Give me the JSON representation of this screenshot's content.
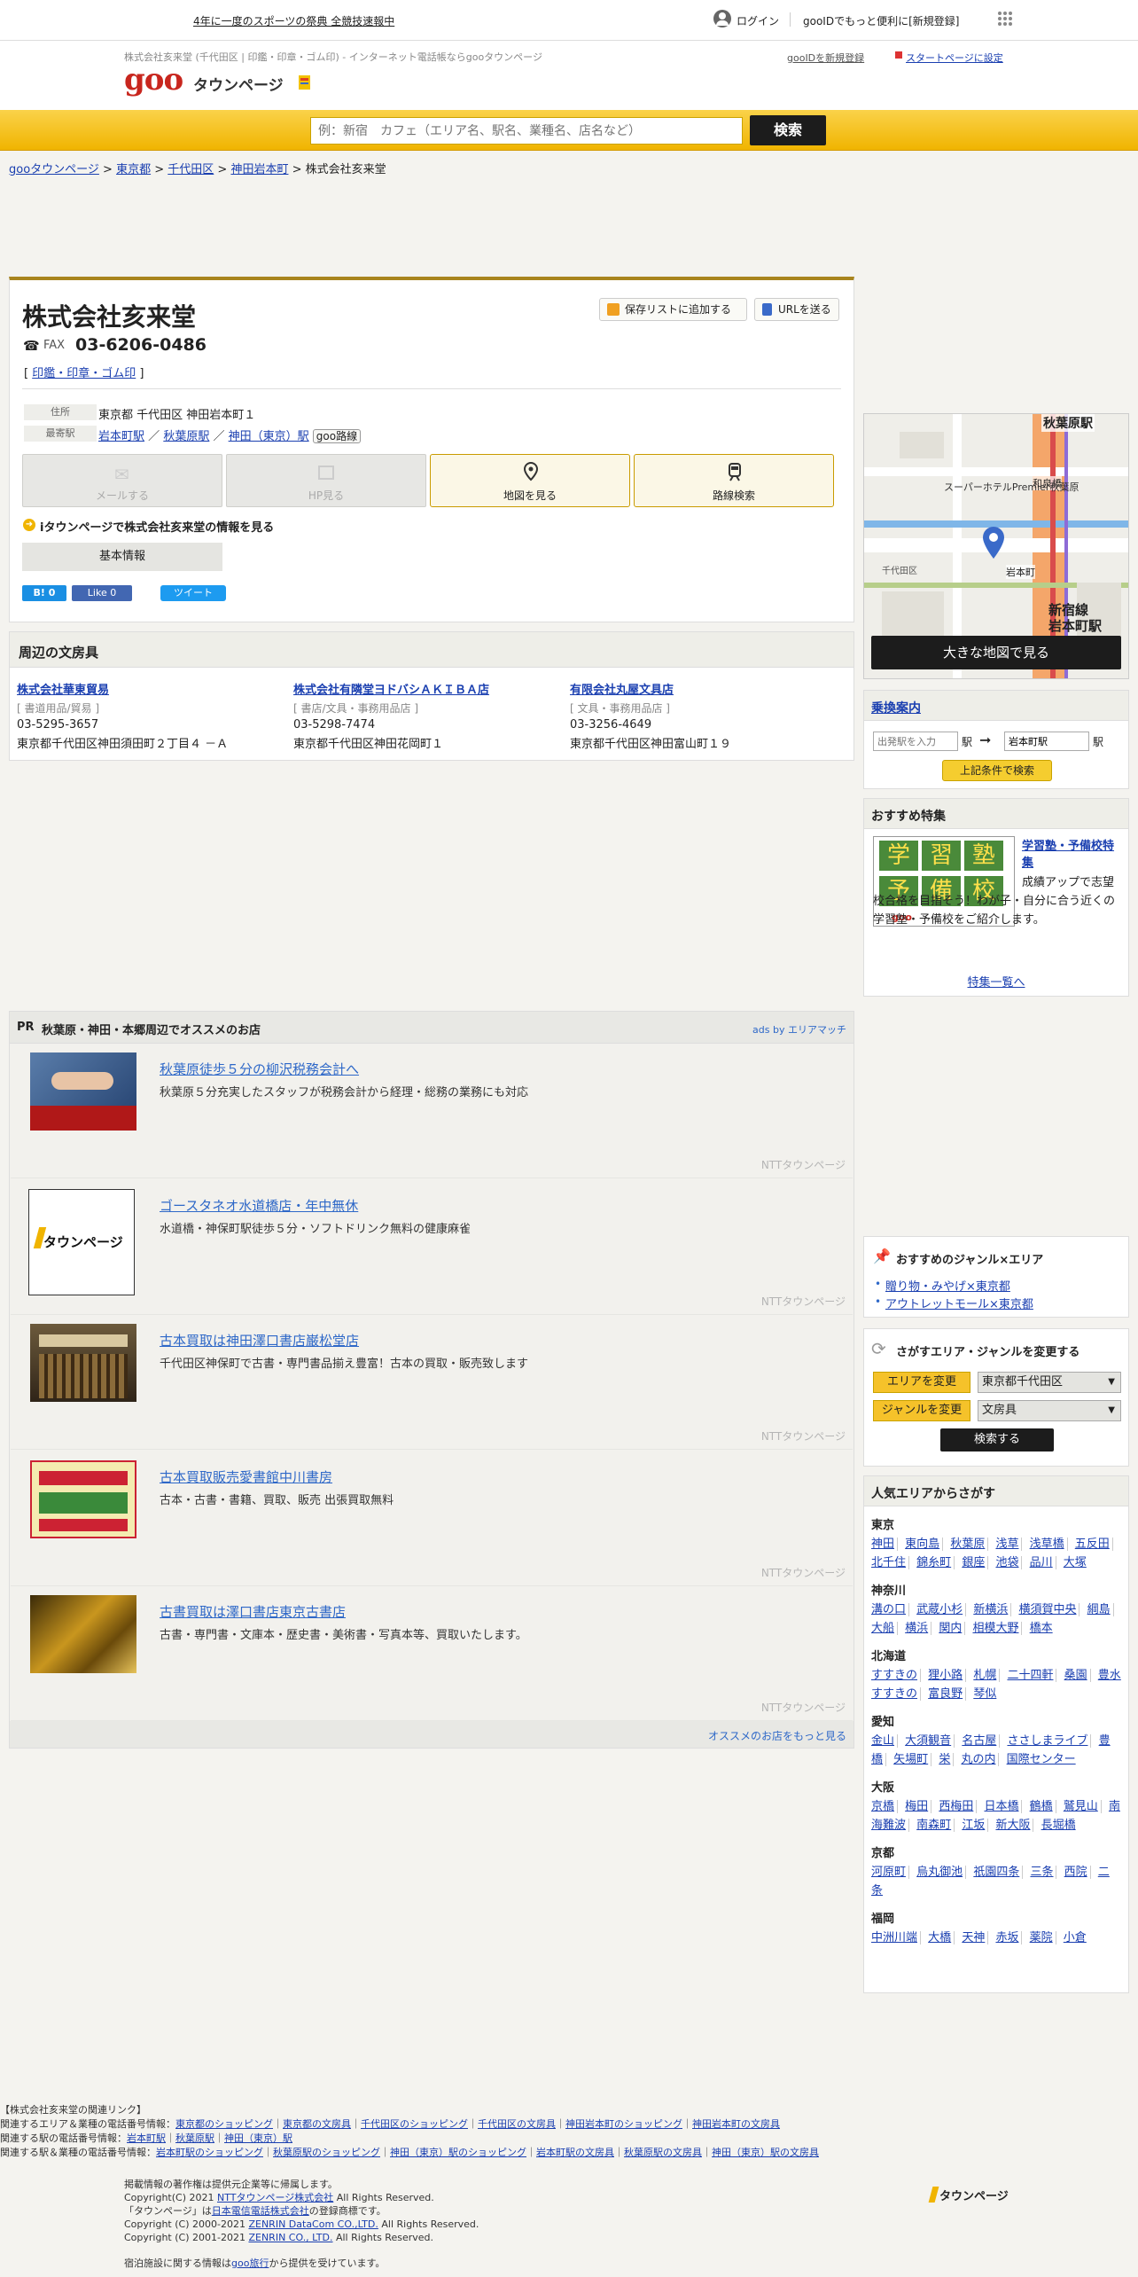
{
  "topbar": {
    "promo": "4年に一度のスポーツの祭典 全競技速報中",
    "login": "ログイン",
    "gooid": "gooIDでもっと便利に[新規登録]"
  },
  "header": {
    "tagline": "株式会社亥来堂 (千代田区 | 印鑑・印章・ゴム印) - インターネット電話帳ならgooタウンページ",
    "logo_goo": "goo",
    "logo_town": "タウンページ",
    "gooid_register": "gooIDを新規登録",
    "startpage": "スタートページに設定"
  },
  "search": {
    "placeholder": "例：新宿　カフェ（エリア名、駅名、業種名、店名など）",
    "button": "検索"
  },
  "breadcrumb": {
    "b1": "gooタウンページ",
    "b2": "東京都",
    "b3": "千代田区",
    "b4": "神田岩本町",
    "current": "株式会社亥来堂",
    "sep": " > "
  },
  "company": {
    "name": "株式会社亥来堂",
    "fax_label": "FAX",
    "fax": "03-6206-0486",
    "category": "印鑑・印章・ゴム印",
    "save_btn": "保存リストに追加する",
    "url_btn": "URLを送る",
    "addr_label": "住所",
    "addr": "東京都 千代田区 神田岩本町１",
    "station_label": "最寄駅",
    "st1": "岩本町駅",
    "st2": "秋葉原駅",
    "st3": "神田（東京）駅",
    "route_tag": "goo路線",
    "slash": "／"
  },
  "actions": {
    "mail": "メールする",
    "hp": "HP見る",
    "map": "地図を見る",
    "route": "路線検索"
  },
  "itown": "iタウンページで株式会社亥来堂の情報を見る",
  "basic_tab": "基本情報",
  "social": {
    "hatena": "B! 0",
    "like": "Like 0",
    "tweet": "ツイート"
  },
  "nearby": {
    "title": "周辺の文房具",
    "items": [
      {
        "name": "株式会社華東貿易",
        "cat": "[ 書道用品/貿易 ]",
        "tel": "03-5295-3657",
        "addr": "東京都千代田区神田須田町２丁目４ －Ａ"
      },
      {
        "name": "株式会社有隣堂ヨドバシＡＫＩＢＡ店",
        "cat": "[ 書店/文具・事務用品店 ]",
        "tel": "03-5298-7474",
        "addr": "東京都千代田区神田花岡町１"
      },
      {
        "name": "有限会社丸屋文具店",
        "cat": "[ 文具・事務用品店 ]",
        "tel": "03-3256-4649",
        "addr": "東京都千代田区神田富山町１９"
      }
    ]
  },
  "pr": {
    "label": "PR",
    "title": "秋葉原・神田・本郷周辺でオススメのお店",
    "ads": "ads by エリアマッチ",
    "ntt": "NTTタウンページ",
    "more": "オススメのお店をもっと見る",
    "items": [
      {
        "title": "秋葉原徒歩５分の柳沢税務会計へ",
        "desc": "秋葉原５分充実したスタッフが税務会計から経理・総務の業務にも対応"
      },
      {
        "title": "ゴースタネオ水道橋店・年中無休",
        "desc": "水道橋・神保町駅徒歩５分・ソフトドリンク無料の健康麻雀"
      },
      {
        "title": "古本買取は神田澤口書店巌松堂店",
        "desc": "千代田区神保町で古書・専門書品揃え豊富！古本の買取・販売致します"
      },
      {
        "title": "古本買取販売愛書館中川書房",
        "desc": "古本・古書・書籍、買取、販売 出張買取無料"
      },
      {
        "title": "古書買取は澤口書店東京古書店",
        "desc": "古書・専門書・文庫本・歴史書・美術書・写真本等、買取いたします。"
      }
    ]
  },
  "map": {
    "labels": {
      "akihabara": "秋葉原駅",
      "iwamotocho": "岩本町",
      "shinjukusen": "新宿線",
      "iwamotocho_eki": "岩本町駅",
      "wazumi": "和泉橋",
      "hotel": "スーパーホテルPremier秋葉原",
      "kanda": "千代田区"
    },
    "button": "大きな地図で見る"
  },
  "transit": {
    "title": "乗換案内",
    "from_placeholder": "出発駅を入力",
    "eki1": "駅",
    "to_value": "岩本町駅",
    "eki2": "駅",
    "button": "上記条件で検索"
  },
  "feature": {
    "title": "おすすめ特集",
    "link": "学習塾・予備校特集",
    "desc": "成績アップで志望校合格を目指そう！わが子・自分に合う近くの学習塾・予備校をご紹介します。",
    "more": "特集一覧へ",
    "img_chars": [
      "学",
      "習",
      "塾",
      "予",
      "備",
      "校"
    ]
  },
  "genre": {
    "title": "おすすめのジャンル×エリア",
    "l1": "贈り物・みやげ×東京都",
    "l2": "アウトレットモール×東京都"
  },
  "change": {
    "title": "さがすエリア・ジャンルを変更する",
    "area_btn": "エリアを変更",
    "area_val": "東京都千代田区",
    "genre_btn": "ジャンルを変更",
    "genre_val": "文房具",
    "search": "検索する"
  },
  "popular": {
    "title": "人気エリアからさがす",
    "regions": [
      {
        "name": "東京",
        "areas": [
          "神田",
          "東向島",
          "秋葉原",
          "浅草",
          "浅草橋",
          "五反田",
          "北千住",
          "錦糸町",
          "銀座",
          "池袋",
          "品川",
          "大塚"
        ]
      },
      {
        "name": "神奈川",
        "areas": [
          "溝の口",
          "武蔵小杉",
          "新横浜",
          "横須賀中央",
          "綱島",
          "大船",
          "横浜",
          "関内",
          "相模大野",
          "橋本"
        ]
      },
      {
        "name": "北海道",
        "areas": [
          "すすきの",
          "狸小路",
          "札幌",
          "二十四軒",
          "桑園",
          "豊水すすきの",
          "富良野",
          "琴似"
        ]
      },
      {
        "name": "愛知",
        "areas": [
          "金山",
          "大須観音",
          "名古屋",
          "ささしまライブ",
          "豊橋",
          "矢場町",
          "栄",
          "丸の内",
          "国際センター"
        ]
      },
      {
        "name": "大阪",
        "areas": [
          "京橋",
          "梅田",
          "西梅田",
          "日本橋",
          "鶴橋",
          "鷲見山",
          "南海難波",
          "南森町",
          "江坂",
          "新大阪",
          "長堀橋"
        ]
      },
      {
        "name": "京都",
        "areas": [
          "河原町",
          "烏丸御池",
          "祇園四条",
          "三条",
          "西院",
          "二条"
        ]
      },
      {
        "name": "福岡",
        "areas": [
          "中洲川端",
          "大橋",
          "天神",
          "赤坂",
          "薬院",
          "小倉"
        ]
      }
    ]
  },
  "related": {
    "head": "【株式会社亥来堂の関連リンク】",
    "r1_label": "関連するエリア＆業種の電話番号情報：",
    "r1": [
      "東京都のショッピング",
      "東京都の文房具",
      "千代田区のショッピング",
      "千代田区の文房具",
      "神田岩本町のショッピング",
      "神田岩本町の文房具"
    ],
    "r2_label": "関連する駅の電話番号情報：",
    "r2": [
      "岩本町駅",
      "秋葉原駅",
      "神田（東京）駅"
    ],
    "r3_label": "関連する駅＆業種の電話番号情報：",
    "r3": [
      "岩本町駅のショッピング",
      "秋葉原駅のショッピング",
      "神田（東京）駅のショッピング",
      "岩本町駅の文房具",
      "秋葉原駅の文房具",
      "神田（東京）駅の文房具"
    ]
  },
  "footer": {
    "l1": "掲載情報の著作権は提供元企業等に帰属します。",
    "l2a": "Copyright(C) 2021 ",
    "l2b": "NTTタウンページ株式会社",
    "l2c": " All Rights Reserved.",
    "l3a": "「タウンページ」は",
    "l3b": "日本電信電話株式会社",
    "l3c": "の登録商標です。",
    "l4a": "Copyright (C) 2000-2021 ",
    "l4b": "ZENRIN DataCom CO.,LTD.",
    "l4c": " All Rights Reserved.",
    "l5a": "Copyright (C) 2001-2021 ",
    "l5b": "ZENRIN CO., LTD.",
    "l5c": " All Rights Reserved.",
    "l6a": "宿泊施設に関する情報は",
    "l6b": "goo旅行",
    "l6c": "から提供を受けています。",
    "logo": "タウンページ"
  }
}
